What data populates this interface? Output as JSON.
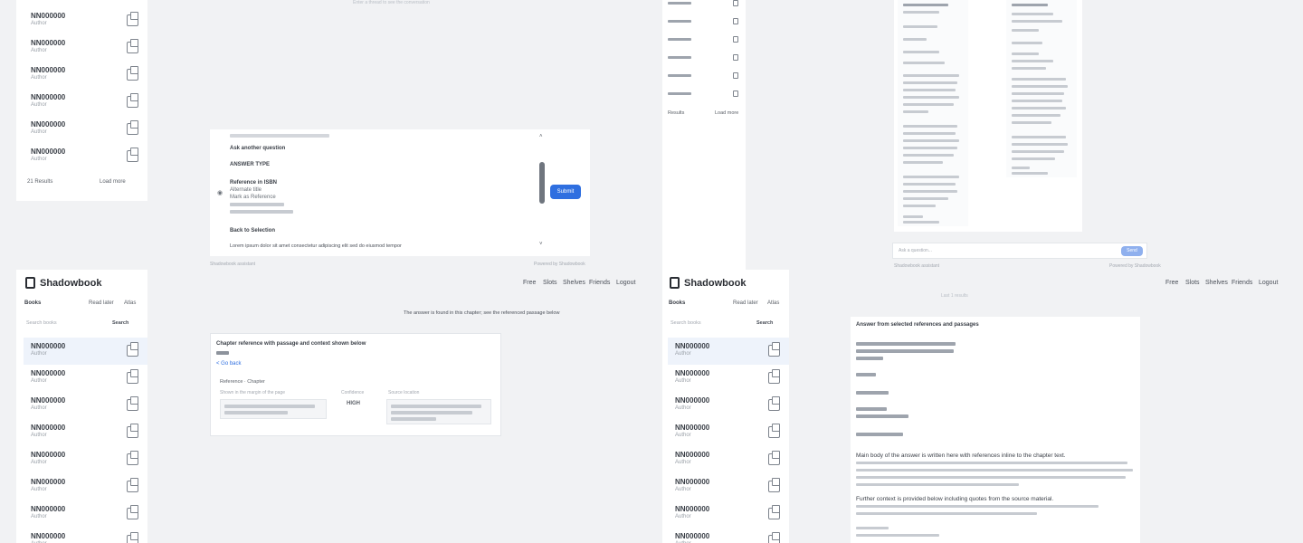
{
  "app": {
    "name": "Shadowbook",
    "nav": [
      "Free",
      "Slots",
      "Shelves",
      "Friends",
      "Logout"
    ],
    "tabs": [
      "Books",
      "Read later",
      "Atlas"
    ],
    "search_placeholder": "Search books",
    "search_button": "Search"
  },
  "left_sidebar_top": {
    "items": [
      {
        "title": "NN000000",
        "sub": "Author"
      },
      {
        "title": "NN000000",
        "sub": "Author"
      },
      {
        "title": "NN000000",
        "sub": "Author"
      },
      {
        "title": "NN000000",
        "sub": "Author"
      },
      {
        "title": "NN000000",
        "sub": "Author"
      },
      {
        "title": "NN000000",
        "sub": "Author"
      }
    ],
    "footer_left": "21 Results",
    "footer_right": "Load more"
  },
  "left_sidebar_bottom": {
    "items": [
      {
        "title": "NN000000",
        "sub": "Author"
      },
      {
        "title": "NN000000",
        "sub": "Author"
      },
      {
        "title": "NN000000",
        "sub": "Author"
      },
      {
        "title": "NN000000",
        "sub": "Author"
      },
      {
        "title": "NN000000",
        "sub": "Author"
      },
      {
        "title": "NN000000",
        "sub": "Author"
      },
      {
        "title": "NN000000",
        "sub": "Author"
      },
      {
        "title": "NN000000",
        "sub": "Author"
      }
    ]
  },
  "center_top": {
    "caption_top": "Enter a thread to see the conversation",
    "options": [
      "Ask another question",
      "ANSWER TYPE",
      "Reference in ISBN",
      "Alternate title",
      "Mark as Reference",
      "Back to Selection"
    ],
    "long_option": "Lorem ipsum dolor sit amet consectetur adipiscing elit sed do eiusmod tempor",
    "submit_label": "Submit",
    "footer_left": "Shadowbook assistant",
    "footer_right": "Powered by Shadowbook"
  },
  "center_bottom": {
    "status_line": "The answer is found in this chapter; see the referenced passage below",
    "card_heading": "Chapter reference with passage and context shown below",
    "card_link": "< Go back",
    "meta_title": "Reference · Chapter",
    "meta_line": "Shown in the margin of the page",
    "col2_label": "Confidence",
    "col2_value": "HIGH",
    "col3_label": "Source location"
  },
  "right_top": {
    "footer_left": "Shadowbook assistant",
    "footer_right": "Powered by Shadowbook",
    "input_placeholder": "Ask a question...",
    "send_label": "Send",
    "caption": "Last 1 results"
  },
  "right_sidebar_top": {
    "footer_left": "Results",
    "footer_right": "Load more"
  },
  "right_doc": {
    "heading": "Answer from selected references and passages",
    "paragraphs": [
      "Main body of the answer is written here with references inline to the chapter text.",
      "Further context is provided below including quotes from the source material."
    ]
  },
  "colors": {
    "accent": "#2f6fe0",
    "background": "#f1f2f4",
    "panel": "#ffffff",
    "active_row": "#eef3fb"
  }
}
